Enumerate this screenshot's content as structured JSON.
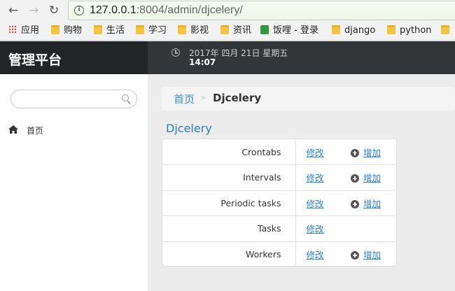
{
  "browser": {
    "url_host": "127.0.0.1",
    "url_rest": ":8004/admin/djcelery/",
    "bookmarks": [
      "应用",
      "购物",
      "生活",
      "学习",
      "影视",
      "资讯",
      "饭哩 - 登录",
      "django",
      "python"
    ]
  },
  "header": {
    "brand": "管理平台",
    "date": "2017年 四月 21日 星期五",
    "time": "14:07"
  },
  "sidebar": {
    "search_placeholder": "",
    "home_label": "首页"
  },
  "breadcrumb": {
    "home": "首页",
    "separator": "»",
    "current": "Djcelery"
  },
  "app": {
    "title": "Djcelery",
    "models": [
      {
        "name": "Crontabs",
        "change": "修改",
        "add": "增加"
      },
      {
        "name": "Intervals",
        "change": "修改",
        "add": "增加"
      },
      {
        "name": "Periodic tasks",
        "change": "修改",
        "add": "增加"
      },
      {
        "name": "Tasks",
        "change": "修改",
        "add": ""
      },
      {
        "name": "Workers",
        "change": "修改",
        "add": "增加"
      }
    ]
  },
  "colors": {
    "link": "#2a7fc0",
    "header_bg": "#333638",
    "brand_bg": "#222426"
  }
}
